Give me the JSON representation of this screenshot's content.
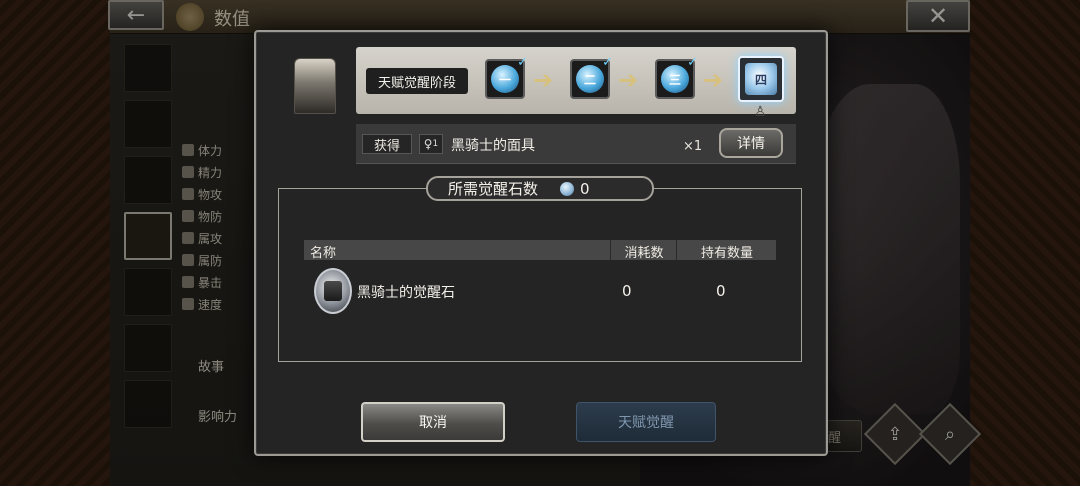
{
  "window": {
    "title": "数值",
    "back_icon": "←",
    "close_icon": "✕"
  },
  "background": {
    "stats": [
      {
        "label": "体力"
      },
      {
        "label": "精力"
      },
      {
        "label": "物攻"
      },
      {
        "label": "物防"
      },
      {
        "label": "属攻"
      },
      {
        "label": "属防"
      },
      {
        "label": "暴击"
      },
      {
        "label": "速度"
      }
    ],
    "side_tabs": [
      "故事",
      "影响力"
    ],
    "awaken_button": "天赋觉醒"
  },
  "modal": {
    "stage_label": "天赋觉醒阶段",
    "stages": [
      {
        "numeral": "一",
        "completed": true
      },
      {
        "numeral": "二",
        "completed": true
      },
      {
        "numeral": "三",
        "completed": true
      },
      {
        "numeral": "四",
        "completed": false
      }
    ],
    "obtain": {
      "label": "获得",
      "icon_badge": "1",
      "item": "黑骑士的面具",
      "quantity": "×1",
      "detail_button": "详情"
    },
    "required": {
      "label": "所需觉醒石数",
      "value": "0"
    },
    "table": {
      "headers": [
        "名称",
        "消耗数",
        "持有数量"
      ],
      "rows": [
        {
          "name": "黑骑士的觉醒石",
          "consumed": "0",
          "held": "0"
        }
      ]
    },
    "cancel_button": "取消",
    "awaken_button": "天赋觉醒"
  },
  "colors": {
    "stage_orb": "#4aa8dc",
    "disabled_button": "#1e2b38",
    "arrow": "#d8c17c"
  }
}
